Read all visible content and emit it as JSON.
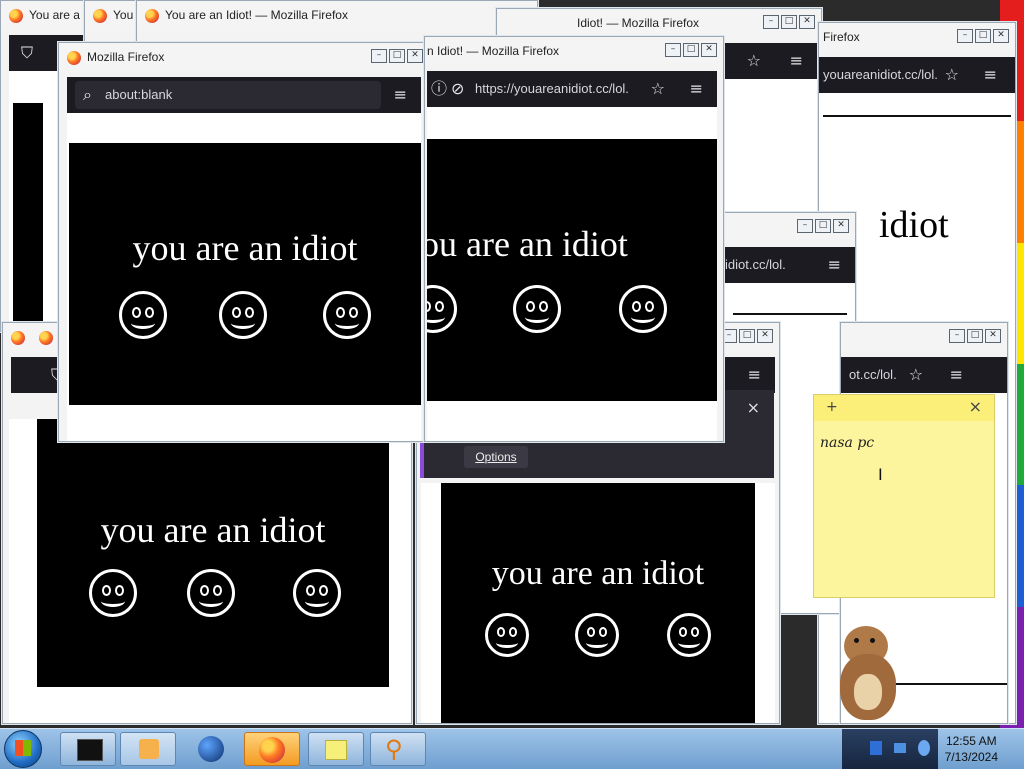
{
  "desktop": {
    "stripe_colors": [
      "#e41d1d",
      "#ff7f00",
      "#ffe600",
      "#1faa3a",
      "#1f5fd6",
      "#7a1fb0"
    ]
  },
  "windows": {
    "bg_title_1": "You are a",
    "bg_title_2": "You",
    "bg_title_3": "You are an Idiot! — Mozilla Firefox",
    "right_title_1": "Idiot! — Mozilla Firefox",
    "right_title_2": "Firefox",
    "right_url_1": "youareanidiot.cc/lol.",
    "mid_small_url": "idiot.cc/lol.",
    "mid_small_url_2": "ot.cc/lol.",
    "main_left_title": "Mozilla Firefox",
    "main_left_url": "about:blank",
    "main_right_title": "n Idiot! — Mozilla Firefox",
    "main_right_url": "https://youareanidiot.cc/lol.",
    "message": "you are an idiot",
    "message_right_partial": "idiot",
    "message_cut_right": "ou are an idiot"
  },
  "notification": {
    "options_label": "Options",
    "close_glyph": "×"
  },
  "sticky_note": {
    "add_glyph": "+",
    "close_glyph": "×",
    "text": "nasa pc"
  },
  "taskbar": {
    "time": "12:55 AM",
    "date": "7/13/2024"
  }
}
